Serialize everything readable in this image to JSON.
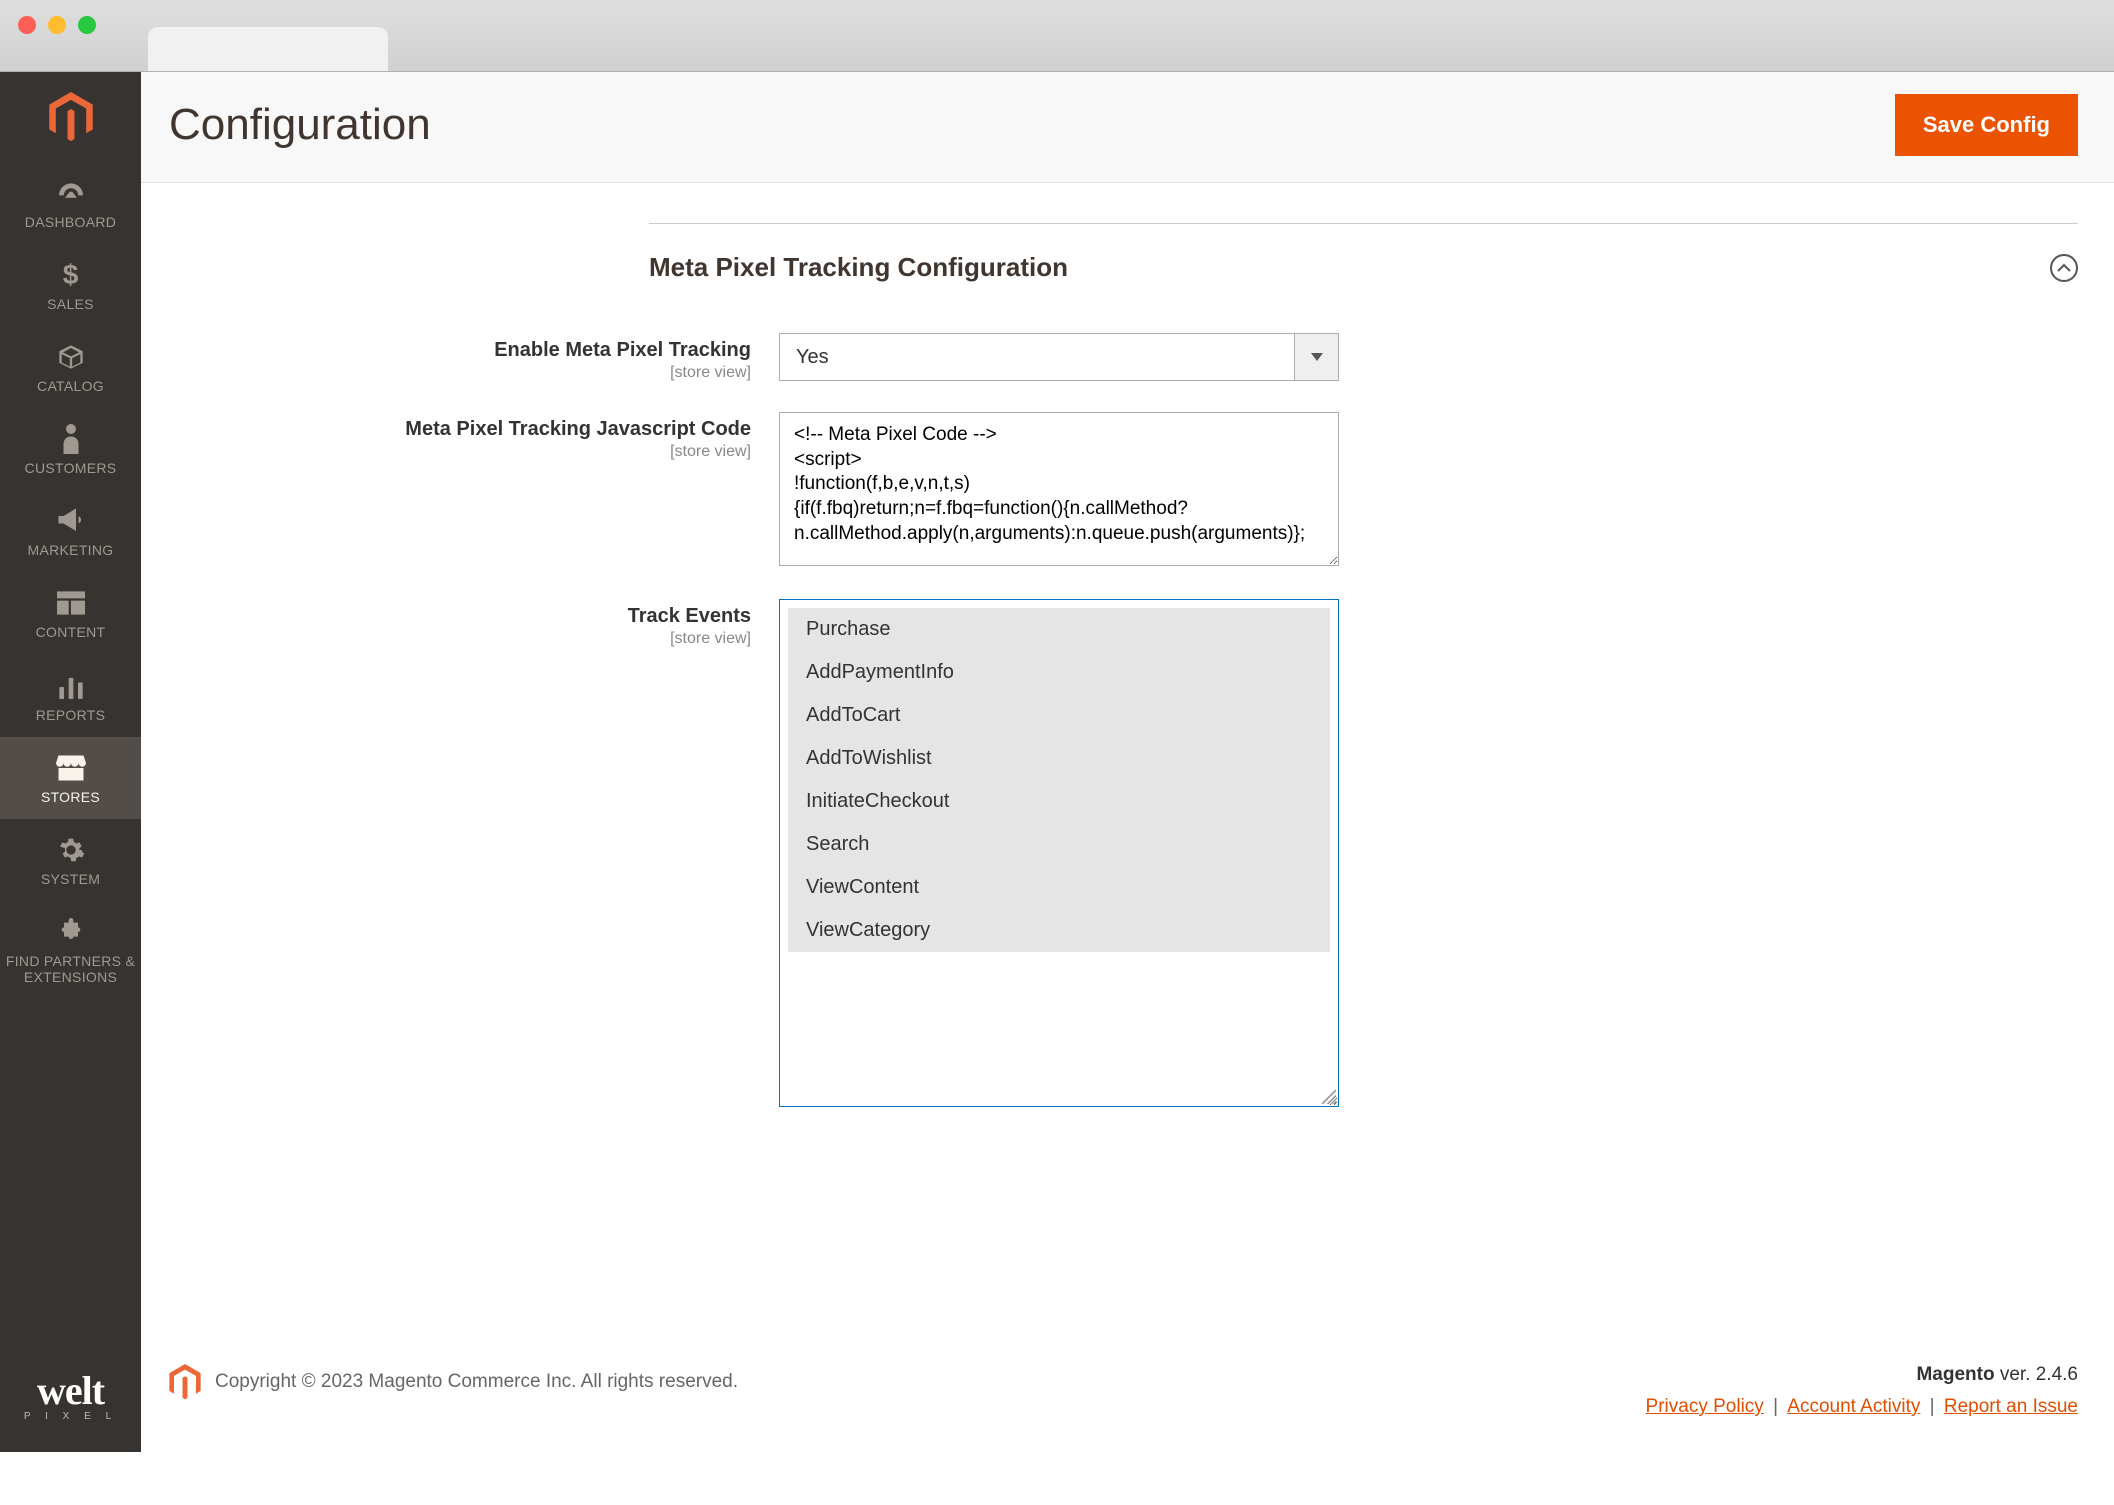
{
  "header": {
    "title": "Configuration",
    "save_button": "Save Config"
  },
  "sidebar": {
    "items": [
      {
        "label": "DASHBOARD"
      },
      {
        "label": "SALES"
      },
      {
        "label": "CATALOG"
      },
      {
        "label": "CUSTOMERS"
      },
      {
        "label": "MARKETING"
      },
      {
        "label": "CONTENT"
      },
      {
        "label": "REPORTS"
      },
      {
        "label": "STORES"
      },
      {
        "label": "SYSTEM"
      },
      {
        "label": "FIND PARTNERS & EXTENSIONS"
      }
    ],
    "welt_brand": "welt",
    "welt_sub": "P I X E L"
  },
  "section": {
    "title": "Meta Pixel Tracking Configuration",
    "fields": {
      "enable": {
        "label": "Enable Meta Pixel Tracking",
        "scope": "[store view]",
        "value": "Yes"
      },
      "jscode": {
        "label": "Meta Pixel Tracking Javascript Code",
        "scope": "[store view]",
        "value": "<!-- Meta Pixel Code -->\n<script>\n!function(f,b,e,v,n,t,s)\n{if(f.fbq)return;n=f.fbq=function(){n.callMethod?\nn.callMethod.apply(n,arguments):n.queue.push(arguments)};"
      },
      "track_events": {
        "label": "Track Events",
        "scope": "[store view]",
        "options": [
          "Purchase",
          "AddPaymentInfo",
          "AddToCart",
          "AddToWishlist",
          "InitiateCheckout",
          "Search",
          "ViewContent",
          "ViewCategory"
        ]
      }
    }
  },
  "footer": {
    "copyright": "Copyright © 2023 Magento Commerce Inc. All rights reserved.",
    "version_label": "Magento",
    "version_value": " ver. 2.4.6",
    "links": {
      "privacy": "Privacy Policy",
      "activity": "Account Activity",
      "report": "Report an Issue"
    },
    "sep": " | "
  },
  "colors": {
    "accent_orange": "#eb5202",
    "sidebar_bg": "#373330",
    "link_orange": "#e04f00"
  }
}
